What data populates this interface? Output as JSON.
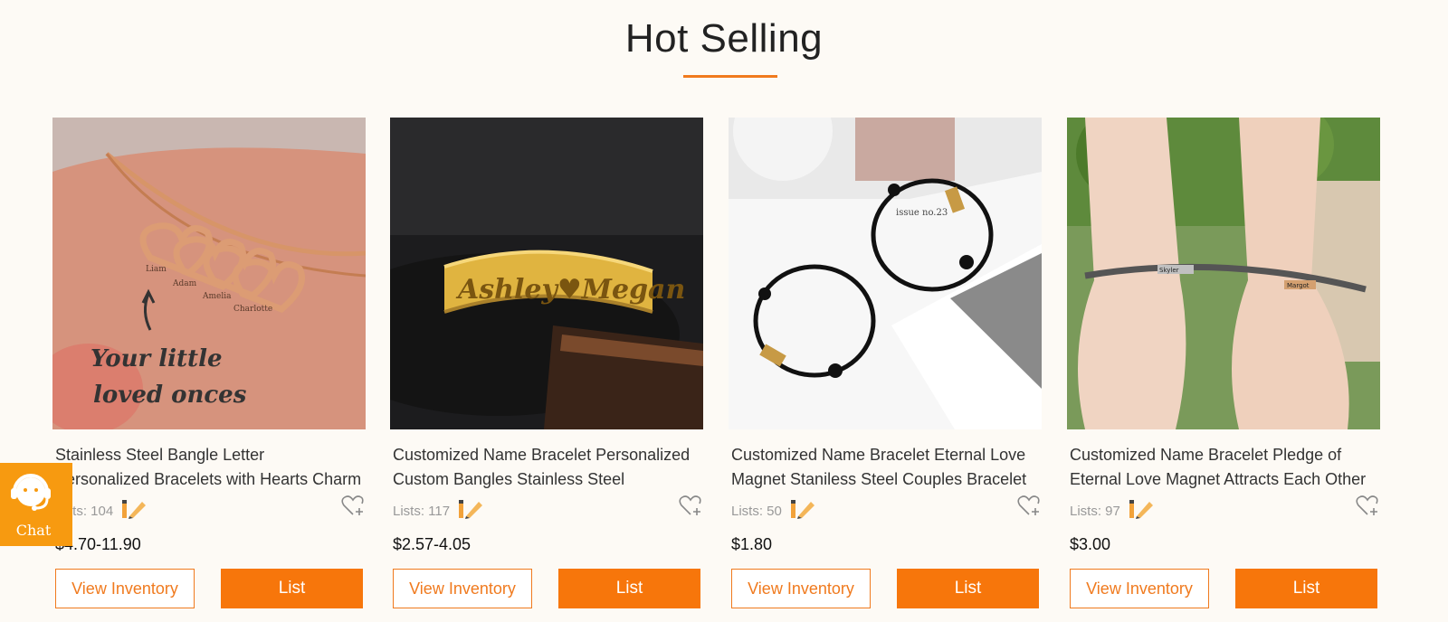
{
  "section": {
    "title": "Hot Selling"
  },
  "products": [
    {
      "name": "Stainless Steel Bangle Letter Personalized Bracelets with Hearts Charm",
      "lists_label": "Lists: 104",
      "price": "$4.70-11.90",
      "view_label": "View Inventory",
      "list_label": "List",
      "image_text": [
        "Your little",
        "loved onces"
      ],
      "heart_names": [
        "Liam",
        "Adam",
        "Amelia",
        "Charlotte"
      ]
    },
    {
      "name": "Customized Name Bracelet Personalized Custom Bangles Stainless Steel",
      "lists_label": "Lists: 117",
      "price": "$2.57-4.05",
      "view_label": "View Inventory",
      "list_label": "List",
      "image_text": "Ashley♥Megan"
    },
    {
      "name": "Customized Name Bracelet Eternal Love Magnet Staniless Steel Couples Bracelet",
      "lists_label": "Lists: 50",
      "price": "$1.80",
      "view_label": "View Inventory",
      "list_label": "List",
      "image_text": "issue no.23"
    },
    {
      "name": "Customized Name Bracelet Pledge of Eternal Love Magnet Attracts Each Other",
      "lists_label": "Lists: 97",
      "price": "$3.00",
      "view_label": "View Inventory",
      "list_label": "List",
      "image_text": [
        "Skyler",
        "Margot"
      ]
    }
  ],
  "chat": {
    "label": "Chat"
  },
  "colors": {
    "accent": "#f7760b",
    "background": "#fdfaf5",
    "chat_bg": "#f79a10"
  }
}
